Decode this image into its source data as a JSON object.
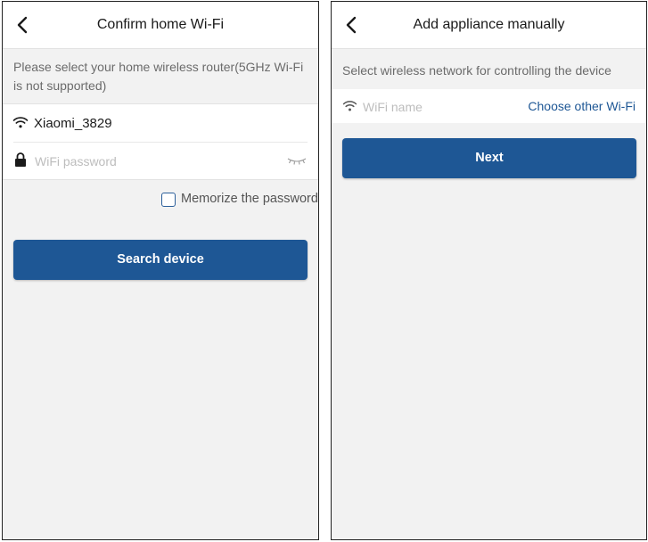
{
  "colors": {
    "primary": "#1e5795",
    "background": "#f2f2f2",
    "hint_text": "#6b6b6b",
    "placeholder": "#bdbdbd"
  },
  "left": {
    "title": "Confirm home Wi-Fi",
    "back_icon": "chevron-left-icon",
    "hint": "Please select your home wireless router(5GHz Wi-Fi is not supported)",
    "wifi_icon": "wifi-icon",
    "ssid": "Xiaomi_3829",
    "lock_icon": "lock-icon",
    "password_placeholder": "WiFi password",
    "password_value": "",
    "visibility_icon": "eye-closed-icon",
    "memorize_label": "Memorize the password",
    "memorize_checked": false,
    "button_label": "Search device"
  },
  "right": {
    "title": "Add appliance manually",
    "back_icon": "chevron-left-icon",
    "hint": "Select wireless network for controlling the device",
    "wifi_icon": "wifi-icon",
    "wifi_name_placeholder": "WiFi name",
    "choose_other_label": "Choose other Wi-Fi",
    "button_label": "Next"
  }
}
